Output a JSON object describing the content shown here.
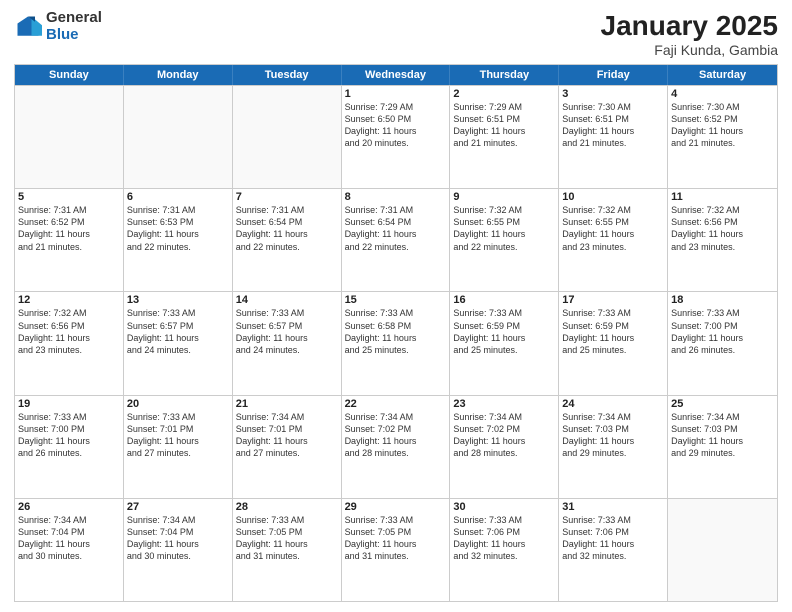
{
  "logo": {
    "general": "General",
    "blue": "Blue"
  },
  "title": "January 2025",
  "subtitle": "Faji Kunda, Gambia",
  "header_days": [
    "Sunday",
    "Monday",
    "Tuesday",
    "Wednesday",
    "Thursday",
    "Friday",
    "Saturday"
  ],
  "weeks": [
    [
      {
        "day": "",
        "info": "",
        "empty": true
      },
      {
        "day": "",
        "info": "",
        "empty": true
      },
      {
        "day": "",
        "info": "",
        "empty": true
      },
      {
        "day": "1",
        "info": "Sunrise: 7:29 AM\nSunset: 6:50 PM\nDaylight: 11 hours\nand 20 minutes."
      },
      {
        "day": "2",
        "info": "Sunrise: 7:29 AM\nSunset: 6:51 PM\nDaylight: 11 hours\nand 21 minutes."
      },
      {
        "day": "3",
        "info": "Sunrise: 7:30 AM\nSunset: 6:51 PM\nDaylight: 11 hours\nand 21 minutes."
      },
      {
        "day": "4",
        "info": "Sunrise: 7:30 AM\nSunset: 6:52 PM\nDaylight: 11 hours\nand 21 minutes."
      }
    ],
    [
      {
        "day": "5",
        "info": "Sunrise: 7:31 AM\nSunset: 6:52 PM\nDaylight: 11 hours\nand 21 minutes."
      },
      {
        "day": "6",
        "info": "Sunrise: 7:31 AM\nSunset: 6:53 PM\nDaylight: 11 hours\nand 22 minutes."
      },
      {
        "day": "7",
        "info": "Sunrise: 7:31 AM\nSunset: 6:54 PM\nDaylight: 11 hours\nand 22 minutes."
      },
      {
        "day": "8",
        "info": "Sunrise: 7:31 AM\nSunset: 6:54 PM\nDaylight: 11 hours\nand 22 minutes."
      },
      {
        "day": "9",
        "info": "Sunrise: 7:32 AM\nSunset: 6:55 PM\nDaylight: 11 hours\nand 22 minutes."
      },
      {
        "day": "10",
        "info": "Sunrise: 7:32 AM\nSunset: 6:55 PM\nDaylight: 11 hours\nand 23 minutes."
      },
      {
        "day": "11",
        "info": "Sunrise: 7:32 AM\nSunset: 6:56 PM\nDaylight: 11 hours\nand 23 minutes."
      }
    ],
    [
      {
        "day": "12",
        "info": "Sunrise: 7:32 AM\nSunset: 6:56 PM\nDaylight: 11 hours\nand 23 minutes."
      },
      {
        "day": "13",
        "info": "Sunrise: 7:33 AM\nSunset: 6:57 PM\nDaylight: 11 hours\nand 24 minutes."
      },
      {
        "day": "14",
        "info": "Sunrise: 7:33 AM\nSunset: 6:57 PM\nDaylight: 11 hours\nand 24 minutes."
      },
      {
        "day": "15",
        "info": "Sunrise: 7:33 AM\nSunset: 6:58 PM\nDaylight: 11 hours\nand 25 minutes."
      },
      {
        "day": "16",
        "info": "Sunrise: 7:33 AM\nSunset: 6:59 PM\nDaylight: 11 hours\nand 25 minutes."
      },
      {
        "day": "17",
        "info": "Sunrise: 7:33 AM\nSunset: 6:59 PM\nDaylight: 11 hours\nand 25 minutes."
      },
      {
        "day": "18",
        "info": "Sunrise: 7:33 AM\nSunset: 7:00 PM\nDaylight: 11 hours\nand 26 minutes."
      }
    ],
    [
      {
        "day": "19",
        "info": "Sunrise: 7:33 AM\nSunset: 7:00 PM\nDaylight: 11 hours\nand 26 minutes."
      },
      {
        "day": "20",
        "info": "Sunrise: 7:33 AM\nSunset: 7:01 PM\nDaylight: 11 hours\nand 27 minutes."
      },
      {
        "day": "21",
        "info": "Sunrise: 7:34 AM\nSunset: 7:01 PM\nDaylight: 11 hours\nand 27 minutes."
      },
      {
        "day": "22",
        "info": "Sunrise: 7:34 AM\nSunset: 7:02 PM\nDaylight: 11 hours\nand 28 minutes."
      },
      {
        "day": "23",
        "info": "Sunrise: 7:34 AM\nSunset: 7:02 PM\nDaylight: 11 hours\nand 28 minutes."
      },
      {
        "day": "24",
        "info": "Sunrise: 7:34 AM\nSunset: 7:03 PM\nDaylight: 11 hours\nand 29 minutes."
      },
      {
        "day": "25",
        "info": "Sunrise: 7:34 AM\nSunset: 7:03 PM\nDaylight: 11 hours\nand 29 minutes."
      }
    ],
    [
      {
        "day": "26",
        "info": "Sunrise: 7:34 AM\nSunset: 7:04 PM\nDaylight: 11 hours\nand 30 minutes."
      },
      {
        "day": "27",
        "info": "Sunrise: 7:34 AM\nSunset: 7:04 PM\nDaylight: 11 hours\nand 30 minutes."
      },
      {
        "day": "28",
        "info": "Sunrise: 7:33 AM\nSunset: 7:05 PM\nDaylight: 11 hours\nand 31 minutes."
      },
      {
        "day": "29",
        "info": "Sunrise: 7:33 AM\nSunset: 7:05 PM\nDaylight: 11 hours\nand 31 minutes."
      },
      {
        "day": "30",
        "info": "Sunrise: 7:33 AM\nSunset: 7:06 PM\nDaylight: 11 hours\nand 32 minutes."
      },
      {
        "day": "31",
        "info": "Sunrise: 7:33 AM\nSunset: 7:06 PM\nDaylight: 11 hours\nand 32 minutes."
      },
      {
        "day": "",
        "info": "",
        "empty": true
      }
    ]
  ]
}
